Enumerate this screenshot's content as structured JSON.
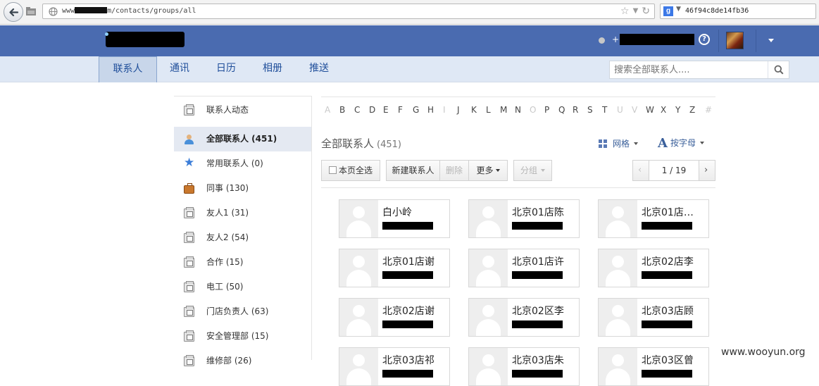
{
  "browser": {
    "url_prefix": "www",
    "url_suffix": "m/contacts/groups/all",
    "search_engine": "g",
    "search_text": "46f94c8de14fb36"
  },
  "header": {
    "user_prefix": "+"
  },
  "tabs": [
    {
      "label": "联系人",
      "active": true
    },
    {
      "label": "通讯",
      "active": false
    },
    {
      "label": "日历",
      "active": false
    },
    {
      "label": "相册",
      "active": false
    },
    {
      "label": "推送",
      "active": false
    }
  ],
  "search": {
    "placeholder": "搜索全部联系人...."
  },
  "sidebar": {
    "items": [
      {
        "label": "联系人动态",
        "icon": "contact-card-icon"
      },
      {
        "label": "全部联系人 (451)",
        "icon": "people-icon",
        "active": true
      },
      {
        "label": "常用联系人 (0)",
        "icon": "star-icon"
      },
      {
        "label": "同事 (130)",
        "icon": "briefcase-icon"
      },
      {
        "label": "友人1 (31)",
        "icon": "contact-card-icon"
      },
      {
        "label": "友人2 (54)",
        "icon": "contact-card-icon"
      },
      {
        "label": "合作 (15)",
        "icon": "contact-card-icon"
      },
      {
        "label": "电工 (50)",
        "icon": "contact-card-icon"
      },
      {
        "label": "门店负责人 (63)",
        "icon": "contact-card-icon"
      },
      {
        "label": "安全管理部 (15)",
        "icon": "contact-card-icon"
      },
      {
        "label": "维修部 (26)",
        "icon": "contact-card-icon"
      }
    ]
  },
  "alphabet": [
    {
      "letter": "A",
      "enabled": false
    },
    {
      "letter": "B",
      "enabled": true
    },
    {
      "letter": "C",
      "enabled": true
    },
    {
      "letter": "D",
      "enabled": true
    },
    {
      "letter": "E",
      "enabled": true
    },
    {
      "letter": "F",
      "enabled": true
    },
    {
      "letter": "G",
      "enabled": true
    },
    {
      "letter": "H",
      "enabled": true
    },
    {
      "letter": "I",
      "enabled": false
    },
    {
      "letter": "J",
      "enabled": true
    },
    {
      "letter": "K",
      "enabled": true
    },
    {
      "letter": "L",
      "enabled": true
    },
    {
      "letter": "M",
      "enabled": true
    },
    {
      "letter": "N",
      "enabled": true
    },
    {
      "letter": "O",
      "enabled": false
    },
    {
      "letter": "P",
      "enabled": true
    },
    {
      "letter": "Q",
      "enabled": true
    },
    {
      "letter": "R",
      "enabled": true
    },
    {
      "letter": "S",
      "enabled": true
    },
    {
      "letter": "T",
      "enabled": true
    },
    {
      "letter": "U",
      "enabled": false
    },
    {
      "letter": "V",
      "enabled": false
    },
    {
      "letter": "W",
      "enabled": true
    },
    {
      "letter": "X",
      "enabled": true
    },
    {
      "letter": "Y",
      "enabled": true
    },
    {
      "letter": "Z",
      "enabled": true
    },
    {
      "letter": "#",
      "enabled": false
    }
  ],
  "main": {
    "title": "全部联系人",
    "count": "(451)",
    "view_label": "网格",
    "sort_label": "按字母"
  },
  "toolbar": {
    "select_all": "本页全选",
    "new_contact": "新建联系人",
    "delete": "删除",
    "more": "更多",
    "group": "分组",
    "page": "1 / 19"
  },
  "contacts": [
    "白小岭",
    "北京01店陈",
    "北京01店…",
    "北京01店谢",
    "北京01店许",
    "北京02店李",
    "北京02店谢",
    "北京02区李",
    "北京03店顾",
    "北京03店祁",
    "北京03店朱",
    "北京03区曾"
  ],
  "watermark": "www.wooyun.org"
}
